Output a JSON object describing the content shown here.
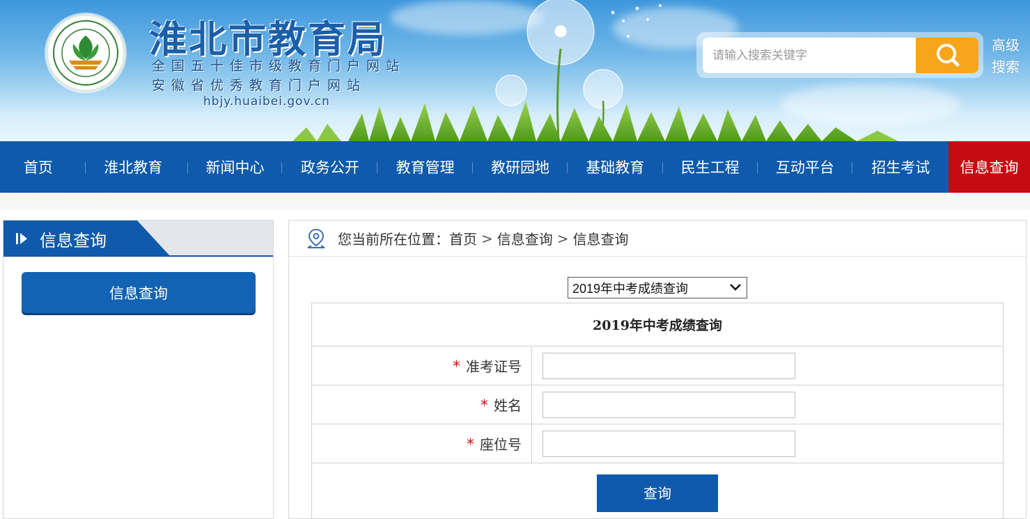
{
  "header": {
    "site_name": "淮北市教育局",
    "slogan_1": "全国五十佳市级教育门户网站",
    "slogan_2": "安徽省优秀教育门户网站",
    "domain": "hbjy.huaibei.gov.cn",
    "search_placeholder": "请输入搜索关键字",
    "advanced_search": "高级搜索"
  },
  "nav": {
    "items": [
      "首页",
      "淮北教育",
      "新闻中心",
      "政务公开",
      "教育管理",
      "教研园地",
      "基础教育",
      "民生工程",
      "互动平台",
      "招生考试",
      "信息查询"
    ],
    "active": "信息查询"
  },
  "sidebar": {
    "title": "信息查询",
    "items": [
      "信息查询"
    ]
  },
  "breadcrumb": {
    "prefix": "您当前所在位置：",
    "path": [
      "首页",
      "信息查询",
      "信息查询"
    ],
    "separator": ">"
  },
  "query": {
    "selected_option": "2019年中考成绩查询",
    "form_title": "2019年中考成绩查询",
    "fields": [
      {
        "label": "准考证号",
        "required": true,
        "value": ""
      },
      {
        "label": "姓名",
        "required": true,
        "value": ""
      },
      {
        "label": "座位号",
        "required": true,
        "value": ""
      }
    ],
    "required_mark": "*",
    "submit_label": "查询"
  },
  "colors": {
    "nav_blue": "#0f5aab",
    "active_red": "#c60b12",
    "search_orange": "#f7a51a",
    "required_red": "#d0101a"
  }
}
